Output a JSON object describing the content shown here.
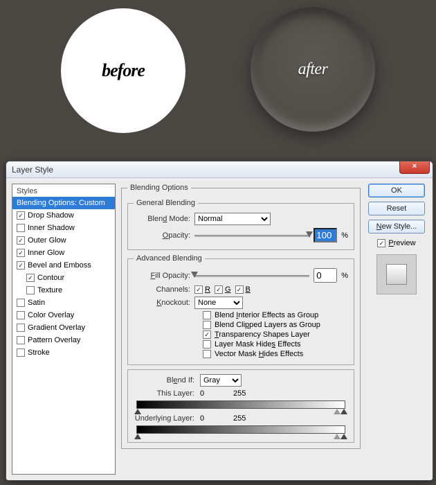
{
  "top": {
    "before": "before",
    "after": "after"
  },
  "dialog": {
    "title": "Layer Style",
    "close": "×",
    "styles": {
      "header": "Styles",
      "selected": "Blending Options: Custom",
      "items": [
        {
          "label": "Drop Shadow",
          "checked": true
        },
        {
          "label": "Inner Shadow",
          "checked": false
        },
        {
          "label": "Outer Glow",
          "checked": true
        },
        {
          "label": "Inner Glow",
          "checked": true
        },
        {
          "label": "Bevel and Emboss",
          "checked": true
        },
        {
          "label": "Contour",
          "checked": true,
          "sub": true
        },
        {
          "label": "Texture",
          "checked": false,
          "sub": true
        },
        {
          "label": "Satin",
          "checked": false
        },
        {
          "label": "Color Overlay",
          "checked": false
        },
        {
          "label": "Gradient Overlay",
          "checked": false
        },
        {
          "label": "Pattern Overlay",
          "checked": false
        },
        {
          "label": "Stroke",
          "checked": false
        }
      ]
    },
    "blending": {
      "legend": "Blending Options",
      "general": {
        "legend": "General Blending",
        "mode_label": "Blend Mode:",
        "mode_value": "Normal",
        "opacity_label": "Opacity:",
        "opacity_value": "100",
        "pct": "%"
      },
      "advanced": {
        "legend": "Advanced Blending",
        "fill_label": "Fill Opacity:",
        "fill_value": "0",
        "pct": "%",
        "channels_label": "Channels:",
        "R": "R",
        "G": "G",
        "B": "B",
        "knockout_label": "Knockout:",
        "knockout_value": "None",
        "opts": {
          "interior": "Blend Interior Effects as Group",
          "clipped": "Blend Clipped Layers as Group",
          "transp": "Transparency Shapes Layer",
          "lmask": "Layer Mask Hides Effects",
          "vmask": "Vector Mask Hides Effects"
        }
      },
      "blendif": {
        "label": "Blend If:",
        "mode": "Gray",
        "thislayer": "This Layer:",
        "underlying": "Underlying Layer:",
        "v0": "0",
        "v255": "255"
      }
    },
    "right": {
      "ok": "OK",
      "reset": "Reset",
      "newstyle": "New Style...",
      "preview": "Preview"
    }
  }
}
